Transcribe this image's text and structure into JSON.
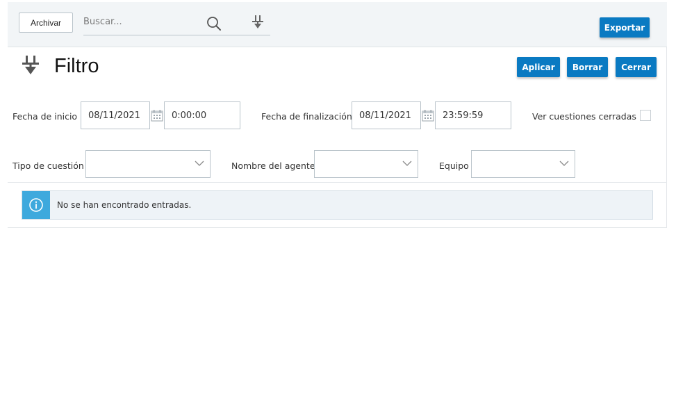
{
  "toolbar": {
    "archive_label": "Archivar",
    "search_placeholder": "Buscar...",
    "export_label": "Exportar"
  },
  "filter_panel": {
    "title": "Filtro",
    "apply_label": "Aplicar",
    "clear_label": "Borrar",
    "close_label": "Cerrar",
    "start_date_label": "Fecha de inicio",
    "start_date_value": "08/11/2021",
    "start_time_value": "0:00:00",
    "end_date_label": "Fecha de finalización",
    "end_date_value": "08/11/2021",
    "end_time_value": "23:59:59",
    "show_closed_label": "Ver cuestiones cerradas",
    "show_closed_checked": false,
    "issue_type_label": "Tipo de cuestión",
    "issue_type_value": "",
    "agent_name_label": "Nombre del agente",
    "agent_name_value": "",
    "team_label": "Equipo",
    "team_value": ""
  },
  "results": {
    "empty_message": "No se han encontrado entradas."
  },
  "colors": {
    "primary": "#0a7ac2",
    "info_accent": "#3ea9dd",
    "toolbar_bg": "#f2f5f7",
    "info_bg": "#eef3f7"
  },
  "icons": [
    "search-icon",
    "filter-icon",
    "calendar-icon",
    "chevron-down-icon",
    "info-icon"
  ]
}
